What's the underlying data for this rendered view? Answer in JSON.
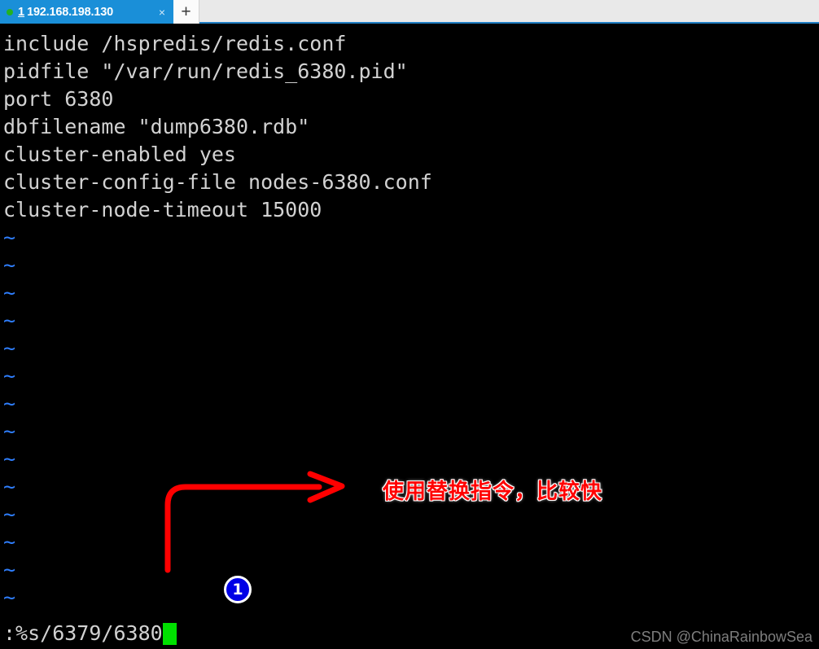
{
  "tabbar": {
    "status_dot": "connected-green",
    "tab_index": "1",
    "tab_title": "192.168.198.130",
    "close_label": "×",
    "new_tab_label": "+"
  },
  "terminal": {
    "lines": [
      "include /hspredis/redis.conf",
      "pidfile \"/var/run/redis_6380.pid\"",
      "port 6380",
      "dbfilename \"dump6380.rdb\"",
      "cluster-enabled yes",
      "cluster-config-file nodes-6380.conf",
      "cluster-node-timeout 15000"
    ],
    "empty_marker": "~",
    "empty_marker_count": 14,
    "command_line": ":%s/6379/6380",
    "cursor": "block-cursor",
    "colors": {
      "background": "#000000",
      "text": "#d2d2d2",
      "tilde": "#2f7fff",
      "cursor": "#00e000"
    }
  },
  "annotations": {
    "note_text": "使用替换指令，比较快",
    "note_color": "#ff0000",
    "badge_number": "1",
    "badge_color": "#0000e6",
    "arrow_color": "#ff0000"
  },
  "watermark": {
    "text": "CSDN @ChinaRainbowSea"
  }
}
